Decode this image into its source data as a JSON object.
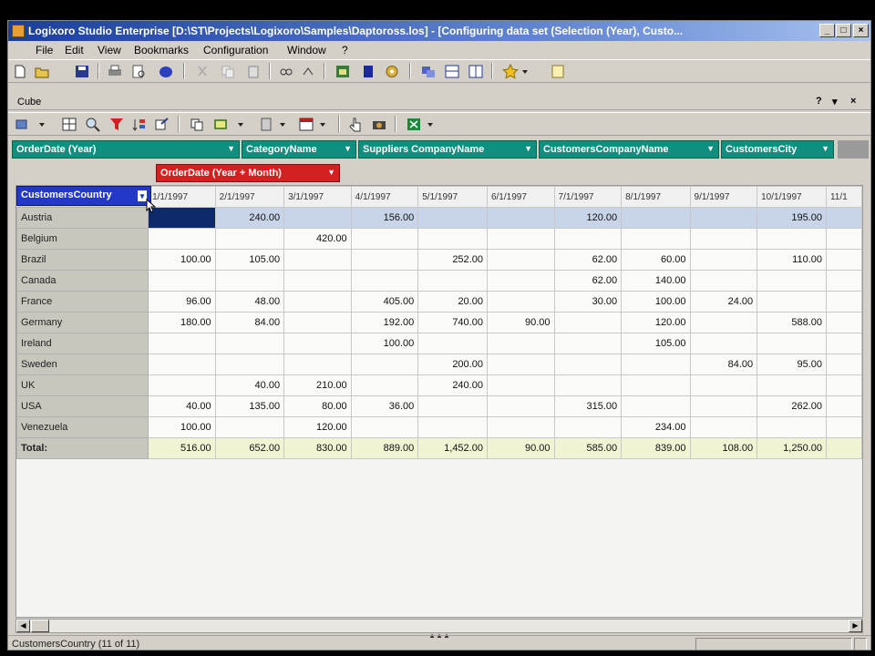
{
  "window": {
    "title": "Logixoro Studio Enterprise [D:\\ST\\Projects\\Logixoro\\Samples\\Daptoross.los] - [Configuring data set (Selection (Year), Custo..."
  },
  "menu": [
    "File",
    "Edit",
    "View",
    "Bookmarks",
    "Configuration",
    "Window",
    "?"
  ],
  "panel": {
    "title": "Cube",
    "controls": [
      "?",
      "▾",
      "×"
    ]
  },
  "fields": {
    "filter_fields": [
      "OrderDate (Year)",
      "CategoryName",
      "Suppliers CompanyName",
      "CustomersCompanyName",
      "CustomersCity"
    ],
    "column_field": "OrderDate (Year + Month)",
    "row_field": "CustomersCountry"
  },
  "table": {
    "columns": [
      "1/1/1997",
      "2/1/1997",
      "3/1/1997",
      "4/1/1997",
      "5/1/1997",
      "6/1/1997",
      "7/1/1997",
      "8/1/1997",
      "9/1/1997",
      "10/1/1997",
      "11/1"
    ],
    "rows": [
      {
        "label": "Austria",
        "values": [
          "",
          "240.00",
          "",
          "156.00",
          "",
          "",
          "120.00",
          "",
          "",
          "195.00",
          ""
        ]
      },
      {
        "label": "Belgium",
        "values": [
          "",
          "",
          "420.00",
          "",
          "",
          "",
          "",
          "",
          "",
          "",
          ""
        ]
      },
      {
        "label": "Brazil",
        "values": [
          "100.00",
          "105.00",
          "",
          "",
          "252.00",
          "",
          "62.00",
          "60.00",
          "",
          "110.00",
          ""
        ]
      },
      {
        "label": "Canada",
        "values": [
          "",
          "",
          "",
          "",
          "",
          "",
          "62.00",
          "140.00",
          "",
          "",
          ""
        ]
      },
      {
        "label": "France",
        "values": [
          "96.00",
          "48.00",
          "",
          "405.00",
          "20.00",
          "",
          "30.00",
          "100.00",
          "24.00",
          "",
          ""
        ]
      },
      {
        "label": "Germany",
        "values": [
          "180.00",
          "84.00",
          "",
          "192.00",
          "740.00",
          "90.00",
          "",
          "120.00",
          "",
          "588.00",
          ""
        ]
      },
      {
        "label": "Ireland",
        "values": [
          "",
          "",
          "",
          "100.00",
          "",
          "",
          "",
          "105.00",
          "",
          "",
          ""
        ]
      },
      {
        "label": "Sweden",
        "values": [
          "",
          "",
          "",
          "",
          "200.00",
          "",
          "",
          "",
          "84.00",
          "95.00",
          ""
        ]
      },
      {
        "label": "UK",
        "values": [
          "",
          "40.00",
          "210.00",
          "",
          "240.00",
          "",
          "",
          "",
          "",
          "",
          ""
        ]
      },
      {
        "label": "USA",
        "values": [
          "40.00",
          "135.00",
          "80.00",
          "36.00",
          "",
          "",
          "315.00",
          "",
          "",
          "262.00",
          ""
        ]
      },
      {
        "label": "Venezuela",
        "values": [
          "100.00",
          "",
          "120.00",
          "",
          "",
          "",
          "",
          "234.00",
          "",
          "",
          ""
        ]
      }
    ],
    "total": {
      "label": "Total:",
      "values": [
        "516.00",
        "652.00",
        "830.00",
        "889.00",
        "1,452.00",
        "90.00",
        "585.00",
        "839.00",
        "108.00",
        "1,250.00",
        ""
      ]
    }
  },
  "status": {
    "text": "CustomersCountry (11 of 11)"
  },
  "colors": {
    "teal_field": "#0f8f7f",
    "red_field": "#d42020",
    "blue_field": "#2438c8",
    "selection": "#c8d4e8"
  }
}
